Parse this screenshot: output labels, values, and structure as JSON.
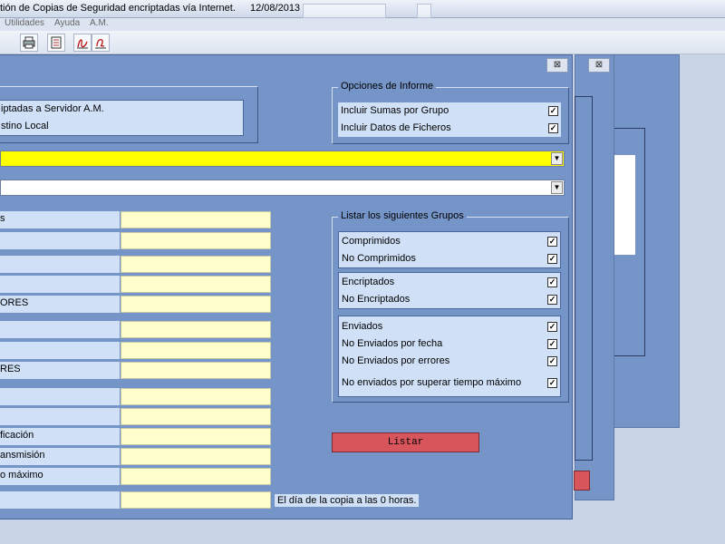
{
  "titlebar": {
    "title": "tión de Copias de Seguridad encriptadas vía Internet.",
    "date": "12/08/2013"
  },
  "menu": [
    "Utilidades",
    "Ayuda",
    "A.M."
  ],
  "toolbar": {
    "icons": [
      "printer-icon",
      "document-icon",
      "signature-icon",
      "signature-alt-icon"
    ]
  },
  "windows": {
    "close_glyph": "⊠"
  },
  "source_frame": {
    "items": [
      "iptadas a Servidor A.M.",
      "stino Local"
    ]
  },
  "informe": {
    "legend": "Opciones de Informe",
    "options": [
      {
        "label": "Incluir Sumas por Grupo",
        "checked": true
      },
      {
        "label": "Incluir Datos de Ficheros",
        "checked": true
      }
    ]
  },
  "combos": {
    "arrow_glyph": "▼"
  },
  "grupos": {
    "legend": "Listar los siguientes Grupos",
    "blocks": [
      [
        {
          "label": "Comprimidos",
          "checked": true
        },
        {
          "label": "No Comprimidos",
          "checked": true
        }
      ],
      [
        {
          "label": "Encriptados",
          "checked": true
        },
        {
          "label": "No Encriptados",
          "checked": true
        }
      ],
      [
        {
          "label": "Enviados",
          "checked": true
        },
        {
          "label": "No Enviados por fecha",
          "checked": true
        },
        {
          "label": "No Enviados por errores",
          "checked": true
        },
        {
          "label": "No enviados por superar tiempo máximo",
          "checked": true
        }
      ]
    ],
    "check_glyph": "✓"
  },
  "fields": [
    {
      "label": "s"
    },
    {
      "label": ""
    },
    {
      "label": ""
    },
    {
      "label": ""
    },
    {
      "label": "ORES"
    },
    {
      "label": ""
    },
    {
      "label": ""
    },
    {
      "label": "RES"
    },
    {
      "label": ""
    },
    {
      "label": ""
    },
    {
      "label": "ficación"
    },
    {
      "label": "ansmisión"
    },
    {
      "label": "o máximo"
    },
    {
      "label": ""
    }
  ],
  "listar_label": "Listar",
  "hint_text": "El día de la copia a las 0 horas.",
  "colors": {
    "window_bg": "#7595c9",
    "highlight_combo": "#ffff00",
    "field_bg": "#ffffcc",
    "listar_button": "#d9555c"
  }
}
